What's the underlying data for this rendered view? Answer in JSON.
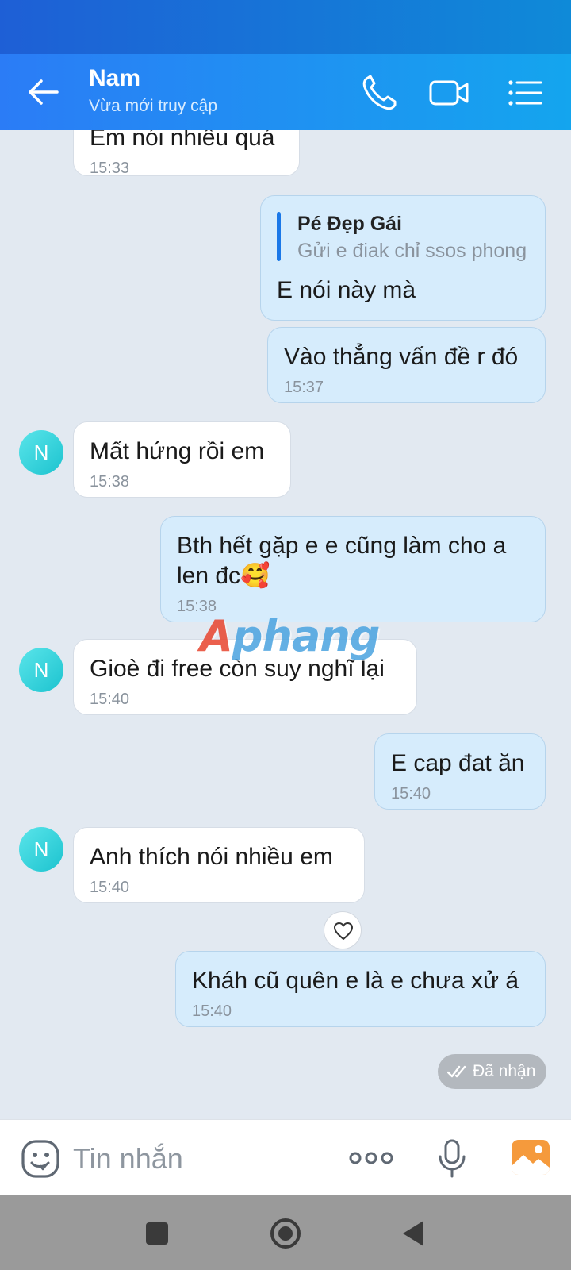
{
  "header": {
    "name": "Nam",
    "status": "Vừa mới truy cập"
  },
  "messages": [
    {
      "dir": "in",
      "text": "Em nói nhiều quá",
      "time": "15:33"
    },
    {
      "dir": "out",
      "quote_name": "Pé Đẹp Gái",
      "quote_text": "Gửi e điak chỉ ssos phong",
      "text": "E nói này mà"
    },
    {
      "dir": "out",
      "text": "Vào thẳng vấn đề r đó",
      "time": "15:37"
    },
    {
      "dir": "in",
      "avatar": "N",
      "text": "Mất hứng rồi em",
      "time": "15:38"
    },
    {
      "dir": "out",
      "text": "Bth hết gặp e e cũng làm cho a len đc🥰",
      "time": "15:38"
    },
    {
      "dir": "in",
      "avatar": "N",
      "text": "Gioè đi free còn suy nghĩ lại",
      "time": "15:40"
    },
    {
      "dir": "out",
      "text": "E cap đat ăn",
      "time": "15:40"
    },
    {
      "dir": "in",
      "avatar": "N",
      "text": "Anh thích nói nhiều em",
      "time": "15:40"
    },
    {
      "dir": "out",
      "text": "Kháh cũ quên e là e chưa xử á",
      "time": "15:40"
    }
  ],
  "delivery_status": "Đã nhận",
  "watermark": {
    "lead": "A",
    "rest": "phang"
  },
  "composer": {
    "placeholder": "Tin nhắn"
  },
  "colors": {
    "header_start": "#2b7cf6",
    "header_end": "#14a5ee",
    "chat_bg": "#e2e9f1",
    "out_bubble": "#d6ecfc",
    "in_bubble": "#ffffff",
    "avatar": "#1cc3cf"
  },
  "icons": [
    "back-arrow-icon",
    "phone-icon",
    "video-call-icon",
    "menu-list-icon",
    "heart-icon",
    "double-check-icon",
    "emoji-icon",
    "more-dots-icon",
    "microphone-icon",
    "gallery-icon",
    "nav-recents-icon",
    "nav-home-icon",
    "nav-back-icon"
  ]
}
